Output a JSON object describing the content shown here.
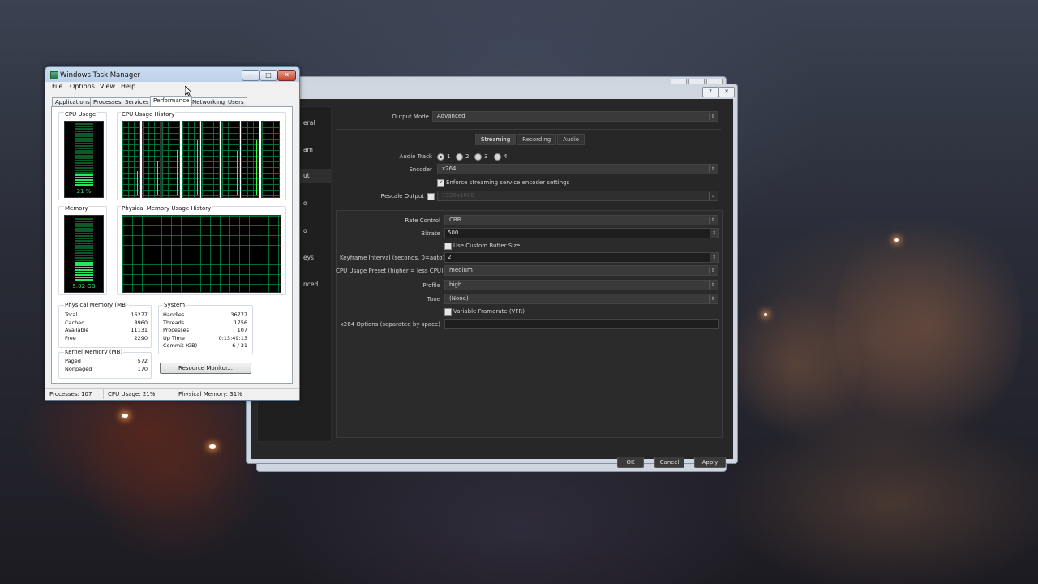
{
  "task_manager": {
    "title": "Windows Task Manager",
    "menu": [
      "File",
      "Options",
      "View",
      "Help"
    ],
    "tabs": [
      "Applications",
      "Processes",
      "Services",
      "Performance",
      "Networking",
      "Users"
    ],
    "active_tab": "Performance",
    "cpu_usage": {
      "label": "CPU Usage",
      "value": "21 %",
      "fraction": 0.21
    },
    "cpu_history_label": "CPU Usage History",
    "memory": {
      "label": "Memory",
      "value": "5.02 GB",
      "fraction": 0.31
    },
    "mem_history_label": "Physical Memory Usage History",
    "physical_memory": {
      "title": "Physical Memory (MB)",
      "rows": [
        {
          "k": "Total",
          "v": "16277"
        },
        {
          "k": "Cached",
          "v": "8960"
        },
        {
          "k": "Available",
          "v": "11131"
        },
        {
          "k": "Free",
          "v": "2290"
        }
      ]
    },
    "system": {
      "title": "System",
      "rows": [
        {
          "k": "Handles",
          "v": "36777"
        },
        {
          "k": "Threads",
          "v": "1756"
        },
        {
          "k": "Processes",
          "v": "107"
        },
        {
          "k": "Up Time",
          "v": "0:13:49:13"
        },
        {
          "k": "Commit (GB)",
          "v": "6 / 31"
        }
      ]
    },
    "kernel_memory": {
      "title": "Kernel Memory (MB)",
      "rows": [
        {
          "k": "Paged",
          "v": "572"
        },
        {
          "k": "Nonpaged",
          "v": "170"
        }
      ]
    },
    "resource_monitor_button": "Resource Monitor...",
    "status": {
      "processes": "Processes: 107",
      "cpu": "CPU Usage: 21%",
      "memory": "Physical Memory: 31%"
    }
  },
  "obs_back": {
    "title": "                                 "
  },
  "obs": {
    "help_button": "?",
    "close_button": "✕",
    "sidebar": [
      "eral",
      "am",
      "ut",
      "o",
      "o",
      "eys",
      "nced"
    ],
    "output_mode_label": "Output Mode",
    "output_mode_value": "Advanced",
    "tabs": [
      "Streaming",
      "Recording",
      "Audio"
    ],
    "active_tab": "Streaming",
    "audio_track_label": "Audio Track",
    "audio_tracks": [
      "1",
      "2",
      "3",
      "4"
    ],
    "audio_track_selected": "1",
    "encoder_label": "Encoder",
    "encoder_value": "x264",
    "enforce_label": "Enforce streaming service encoder settings",
    "enforce_checked": true,
    "rescale_label": "Rescale Output",
    "rescale_value": "1920x1080",
    "rate_control_label": "Rate Control",
    "rate_control_value": "CBR",
    "bitrate_label": "Bitrate",
    "bitrate_value": "500",
    "custom_buffer_label": "Use Custom Buffer Size",
    "keyframe_label": "Keyframe Interval (seconds, 0=auto)",
    "keyframe_value": "2",
    "cpu_preset_label": "CPU Usage Preset (higher = less CPU)",
    "cpu_preset_value": "medium",
    "profile_label": "Profile",
    "profile_value": "high",
    "tune_label": "Tune",
    "tune_value": "(None)",
    "vfr_label": "Variable Framerate (VFR)",
    "x264_opts_label": "x264 Options (separated by space)",
    "x264_opts_value": "",
    "ok": "OK",
    "cancel": "Cancel",
    "apply": "Apply"
  }
}
